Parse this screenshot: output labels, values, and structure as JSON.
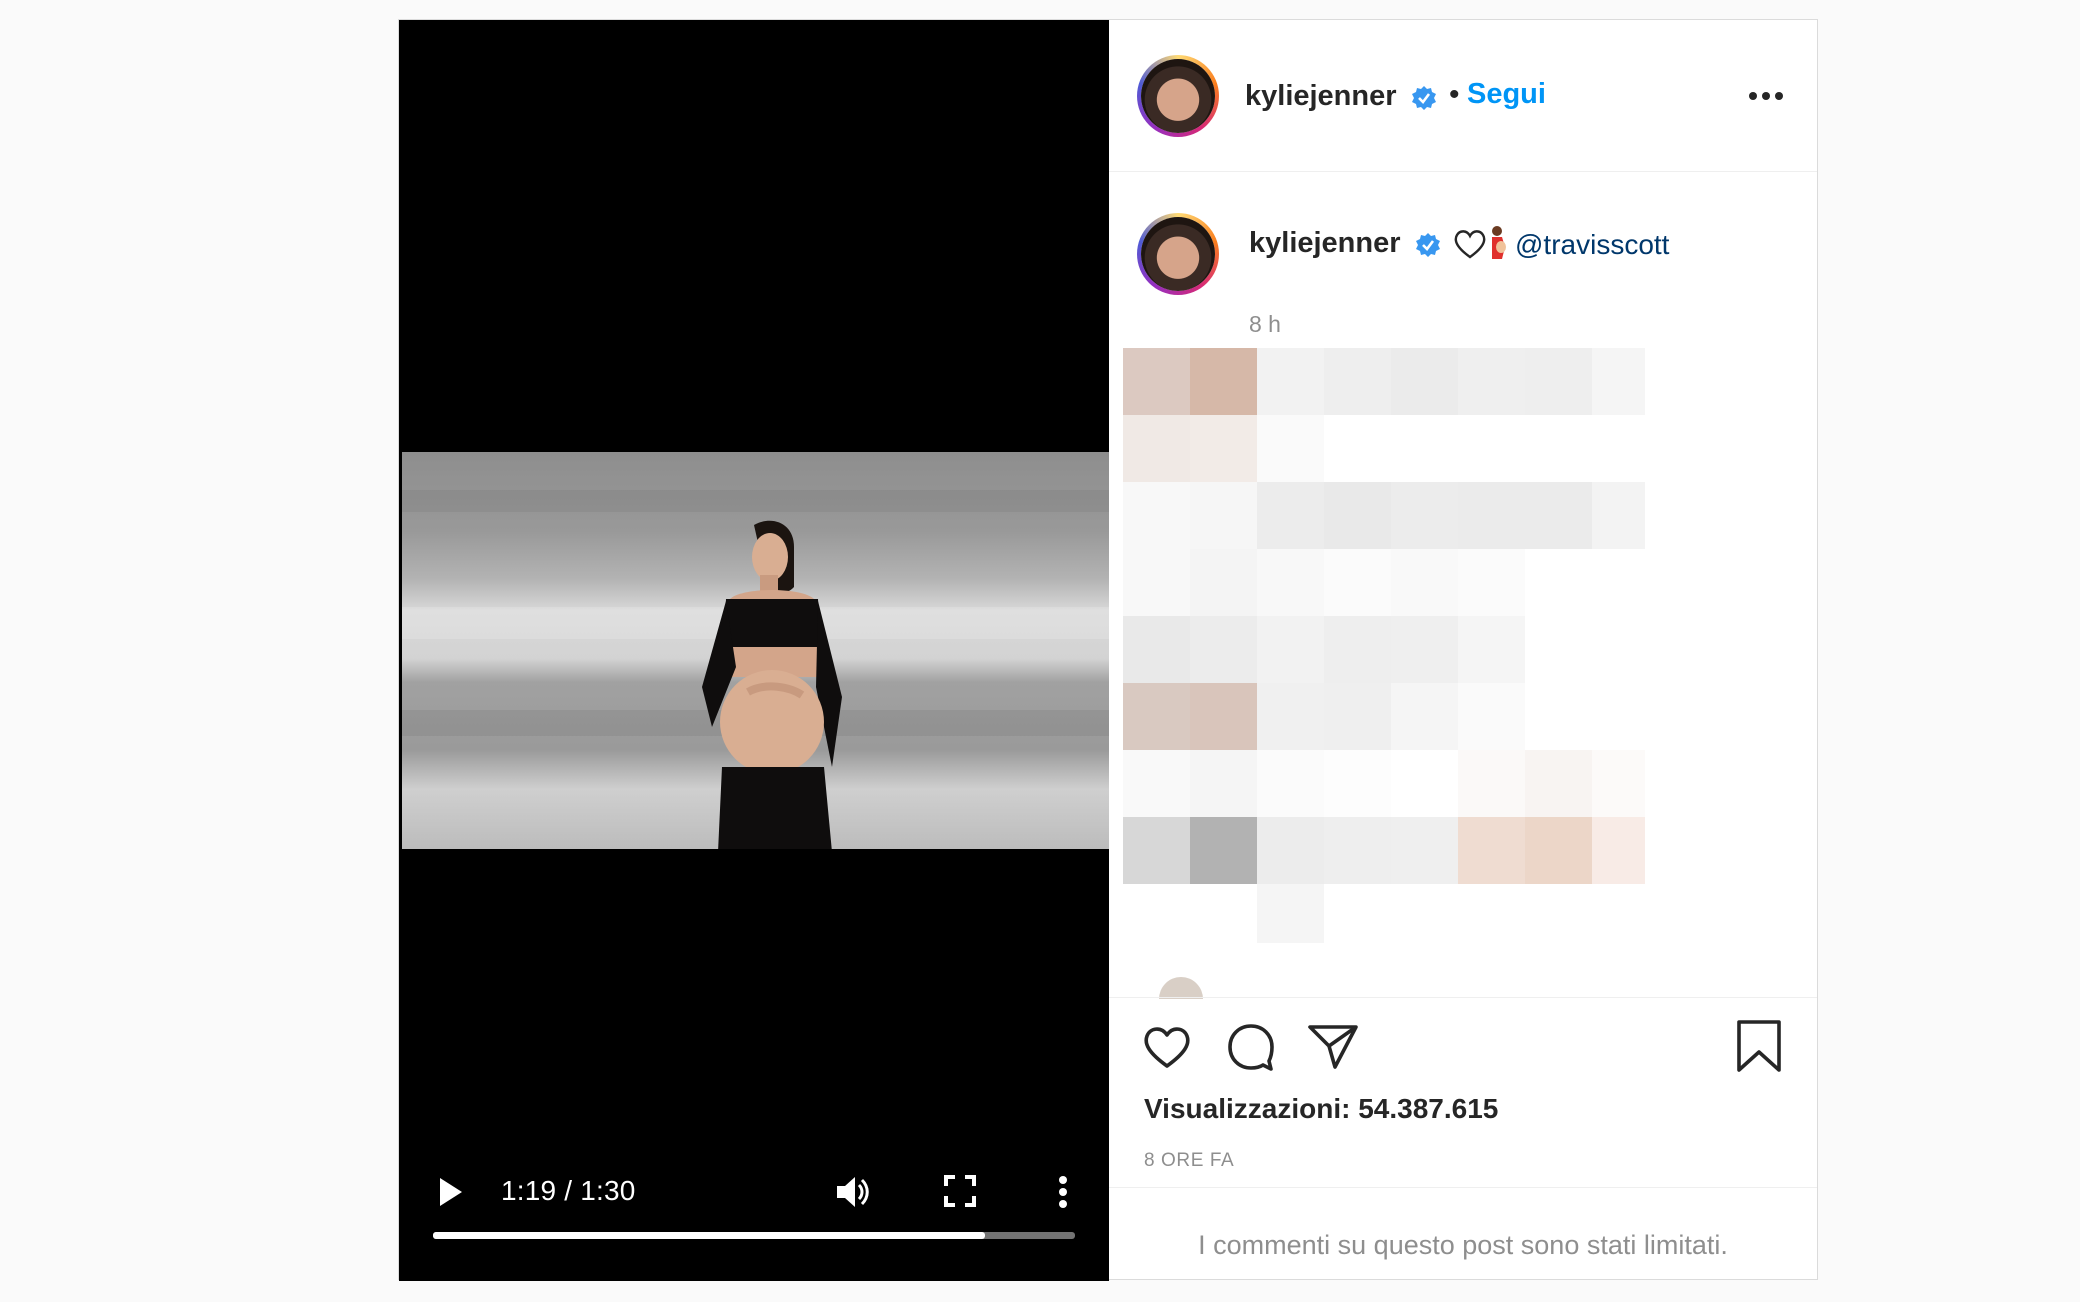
{
  "video": {
    "time": "1:19 / 1:30",
    "progress_fraction": 0.86
  },
  "header": {
    "username": "kyliejenner",
    "separator": "•",
    "follow_label": "Segui"
  },
  "caption": {
    "username": "kyliejenner",
    "mention": "@travisscott",
    "timestamp": "8 h"
  },
  "stats": {
    "views_label": "Visualizzazioni:",
    "views_count": "54.387.615",
    "posted": "8 ORE FA"
  },
  "comments": {
    "limited_notice": "I commenti su questo post sono stati limitati."
  },
  "icons": {
    "verified": "verified-badge-icon",
    "like": "heart-icon",
    "comment": "comment-icon",
    "share": "paper-plane-icon",
    "save": "bookmark-icon",
    "more": "more-options-icon",
    "play": "play-icon",
    "volume": "volume-icon",
    "fullscreen": "fullscreen-icon",
    "video_menu": "kebab-menu-icon"
  },
  "colors": {
    "accent_blue": "#0095f6",
    "mention_blue": "#00376b",
    "verified_blue": "#3897f0",
    "text": "#262626",
    "muted": "#8e8e8e"
  }
}
